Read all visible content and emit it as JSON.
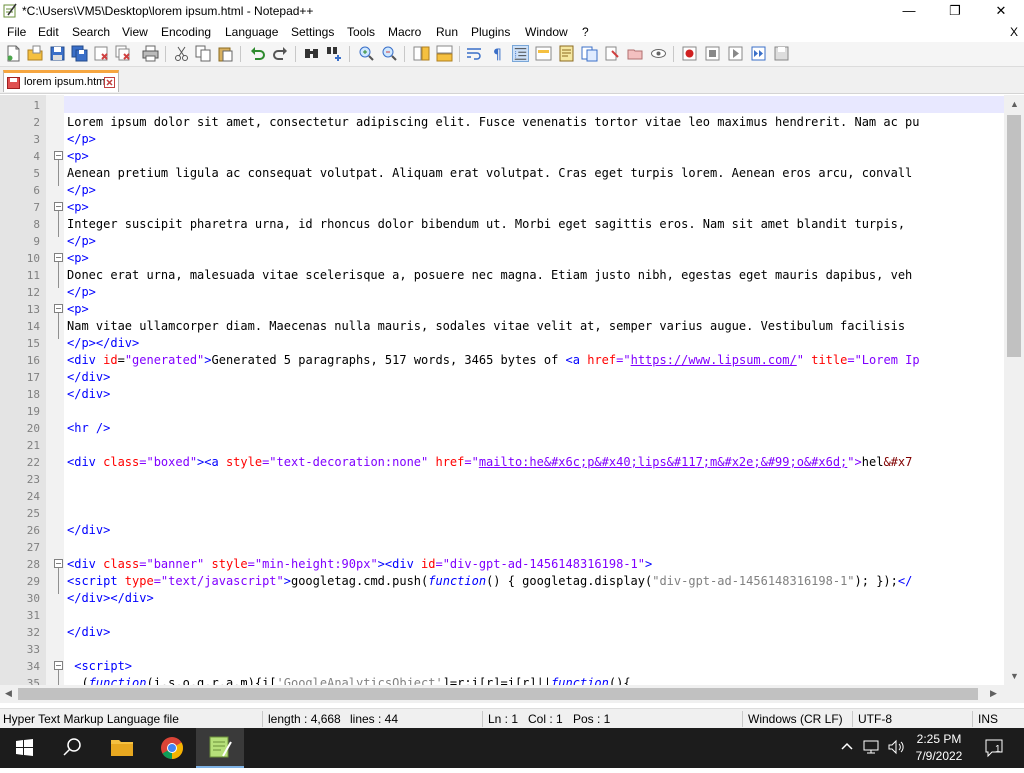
{
  "window": {
    "title": "*C:\\Users\\VM5\\Desktop\\lorem ipsum.html - Notepad++",
    "controls": {
      "minimize": "—",
      "maximize": "❐",
      "close": "✕"
    }
  },
  "menu": {
    "items": [
      "File",
      "Edit",
      "Search",
      "View",
      "Encoding",
      "Language",
      "Settings",
      "Tools",
      "Macro",
      "Run",
      "Plugins",
      "Window",
      "?"
    ],
    "close_label": "X"
  },
  "toolbar": {
    "icons": [
      "new-file-icon",
      "open-file-icon",
      "save-icon",
      "save-all-icon",
      "close-icon",
      "close-all-icon",
      "print-icon",
      "cut-icon",
      "copy-icon",
      "paste-icon",
      "undo-icon",
      "redo-icon",
      "find-icon",
      "replace-icon",
      "zoom-in-icon",
      "zoom-out-icon",
      "sync-vertical-icon",
      "sync-horizontal-icon",
      "word-wrap-icon",
      "show-all-characters-icon",
      "indent-guide-icon",
      "user-language-icon",
      "document-map-icon",
      "function-list-icon",
      "folder-as-workspace-icon",
      "monitoring-icon",
      "record-macro-icon",
      "stop-recording-icon",
      "playback-icon",
      "run-macro-multiple-icon",
      "save-macro-icon"
    ]
  },
  "tabs": [
    {
      "label": "lorem ipsum.html",
      "modified": true
    }
  ],
  "editor": {
    "line_numbers": [
      "1",
      "2",
      "3",
      "4",
      "5",
      "6",
      "7",
      "8",
      "9",
      "10",
      "11",
      "12",
      "13",
      "14",
      "15",
      "16",
      "17",
      "18",
      "19",
      "20",
      "21",
      "22",
      "23",
      "24",
      "25",
      "26",
      "27",
      "28",
      "29",
      "30",
      "31",
      "32",
      "33",
      "34",
      "35"
    ],
    "lines": {
      "l2": "Lorem ipsum dolor sit amet, consectetur adipiscing elit. Fusce venenatis tortor vitae leo maximus hendrerit. Nam ac pu",
      "l3": "</p>",
      "l4": "<p>",
      "l5": "Aenean pretium ligula ac consequat volutpat. Aliquam erat volutpat. Cras eget turpis lorem. Aenean eros arcu, convall",
      "l6": "</p>",
      "l7": "<p>",
      "l8": "Integer suscipit pharetra urna, id rhoncus dolor bibendum ut. Morbi eget sagittis eros. Nam sit amet blandit turpis, ",
      "l9": "</p>",
      "l10": "<p>",
      "l11": "Donec erat urna, malesuada vitae scelerisque a, posuere nec magna. Etiam justo nibh, egestas eget mauris dapibus, veh",
      "l12": "</p>",
      "l13": "<p>",
      "l14": "Nam vitae ullamcorper diam. Maecenas nulla mauris, sodales vitae velit at, semper varius augue. Vestibulum facilisis ",
      "l15": "</p></div>",
      "l16_open": "<div ",
      "l16_attr": "id",
      "l16_eq": "=",
      "l16_val": "\"generated\"",
      "l16_close": ">",
      "l16_text": "Generated 5 paragraphs, 517 words, 3465 bytes of ",
      "l16_a": "<a ",
      "l16_href": "href",
      "l16_q1": "=\"",
      "l16_link": "https://www.lipsum.com/",
      "l16_q2": "\" ",
      "l16_title": "title",
      "l16_titleval": "=\"Lorem Ip",
      "l17": "</div>",
      "l18": "</div>",
      "l20": "<hr />",
      "l22_open": "<div ",
      "l22_class": "class",
      "l22_classval": "=\"boxed\"",
      "l22_close": "><a ",
      "l22_style": "style",
      "l22_styleval": "=\"text-decoration:none\" ",
      "l22_href": "href",
      "l22_q": "=\"",
      "l22_link": "mailto:he&#x6c;p&#x40;lips&#117;m&#x2e;&#99;o&#x6d;",
      "l22_end": "\">",
      "l22_text": "hel",
      "l22_ent": "&#x7",
      "l26": "</div>",
      "l28_open": "<div ",
      "l28_class": "class",
      "l28_classval": "=\"banner\" ",
      "l28_style": "style",
      "l28_styleval": "=\"min-height:90px\"",
      "l28_mid": "><div ",
      "l28_id": "id",
      "l28_idval": "=\"div-gpt-ad-1456148316198-1\"",
      "l28_end": ">",
      "l29_open": "<script ",
      "l29_type": "type",
      "l29_typeval": "=\"text/javascript\"",
      "l29_gt": ">",
      "l29_text1": "googletag.cmd.push(",
      "l29_fn": "function",
      "l29_text2": "() { googletag.display(",
      "l29_str": "\"div-gpt-ad-1456148316198-1\"",
      "l29_text3": "); });",
      "l29_end": "</",
      "l30": "</div></div>",
      "l32": "</div>",
      "l34": " <script>",
      "l35_a": "  (",
      "l35_fn": "function",
      "l35_b": "(i,s,o,g,r,a,m){i[",
      "l35_str": "'GoogleAnalyticsObject'",
      "l35_c": "]=r;i[r]=i[r]||",
      "l35_fn2": "function",
      "l35_d": "(){"
    }
  },
  "status": {
    "file_type": "Hyper Text Markup Language file",
    "length": "length : 4,668",
    "lines": "lines : 44",
    "ln": "Ln : 1",
    "col": "Col : 1",
    "pos": "Pos : 1",
    "eol": "Windows (CR LF)",
    "encoding": "UTF-8",
    "mode": "INS"
  },
  "taskbar": {
    "icons": [
      "windows-start-icon",
      "search-icon",
      "file-explorer-icon",
      "chrome-icon",
      "notepad-plus-plus-icon"
    ],
    "time": "2:25 PM",
    "date": "7/9/2022",
    "notification_count": "1"
  },
  "colors": {
    "tag": "#0000ff",
    "attribute": "#ff0000",
    "value": "#8000ff",
    "tab_accent": "#f6a640"
  }
}
